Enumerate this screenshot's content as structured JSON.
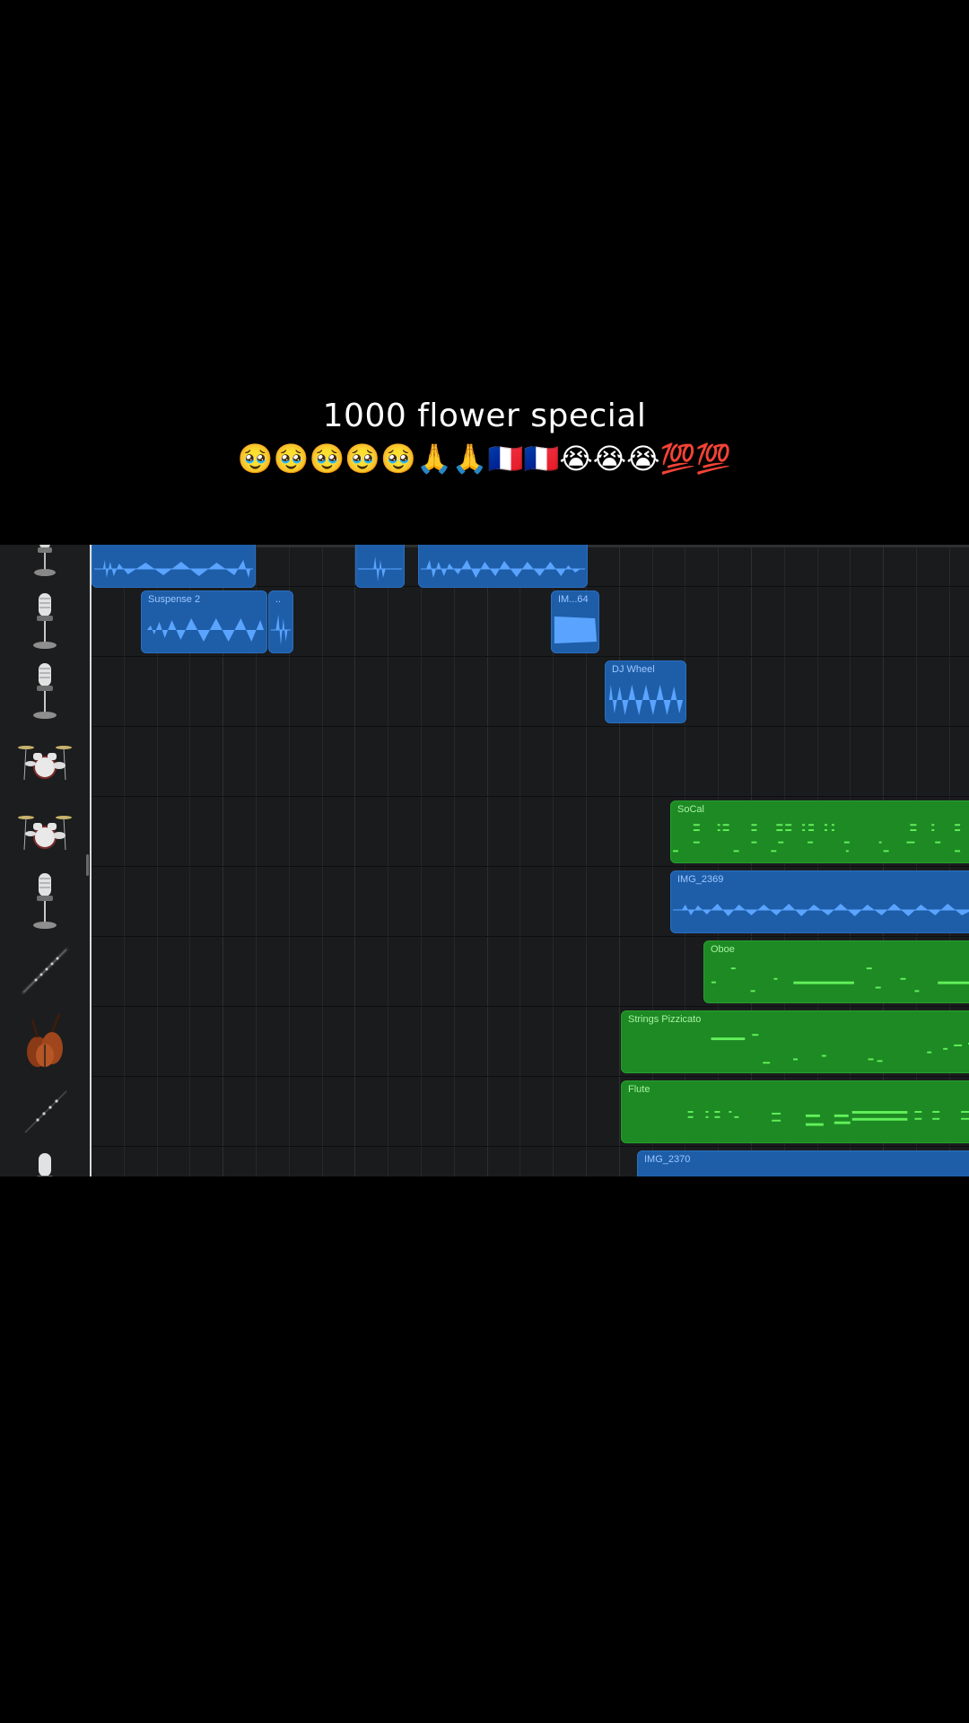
{
  "caption": {
    "title": "1000 flower special",
    "emoji": "🥹🥹🥹🥹🥹🙏🙏🇫🇷🇫🇷😭😭😭💯💯"
  },
  "tracks": [
    {
      "icon": "microphone-icon"
    },
    {
      "icon": "microphone-icon"
    },
    {
      "icon": "microphone-icon"
    },
    {
      "icon": "drum-kit-icon"
    },
    {
      "icon": "drum-kit-icon"
    },
    {
      "icon": "microphone-icon"
    },
    {
      "icon": "oboe-icon"
    },
    {
      "icon": "strings-icon"
    },
    {
      "icon": "flute-icon"
    },
    {
      "icon": "microphone-icon"
    }
  ],
  "regions": {
    "suspense": "Suspense 2",
    "tiny": "..",
    "im64": "IM...64",
    "djwheel": "DJ Wheel",
    "socal": "SoCal",
    "img2369": "IMG_2369",
    "oboe": "Oboe",
    "strings": "Strings Pizzicato",
    "flute": "Flute",
    "img2370": "IMG_2370"
  },
  "colors": {
    "audio_region": "#1e5ea9",
    "waveform": "#5aa4ff",
    "midi_region": "#1d8a24",
    "midi_note": "#62f05a",
    "background": "#000000"
  }
}
